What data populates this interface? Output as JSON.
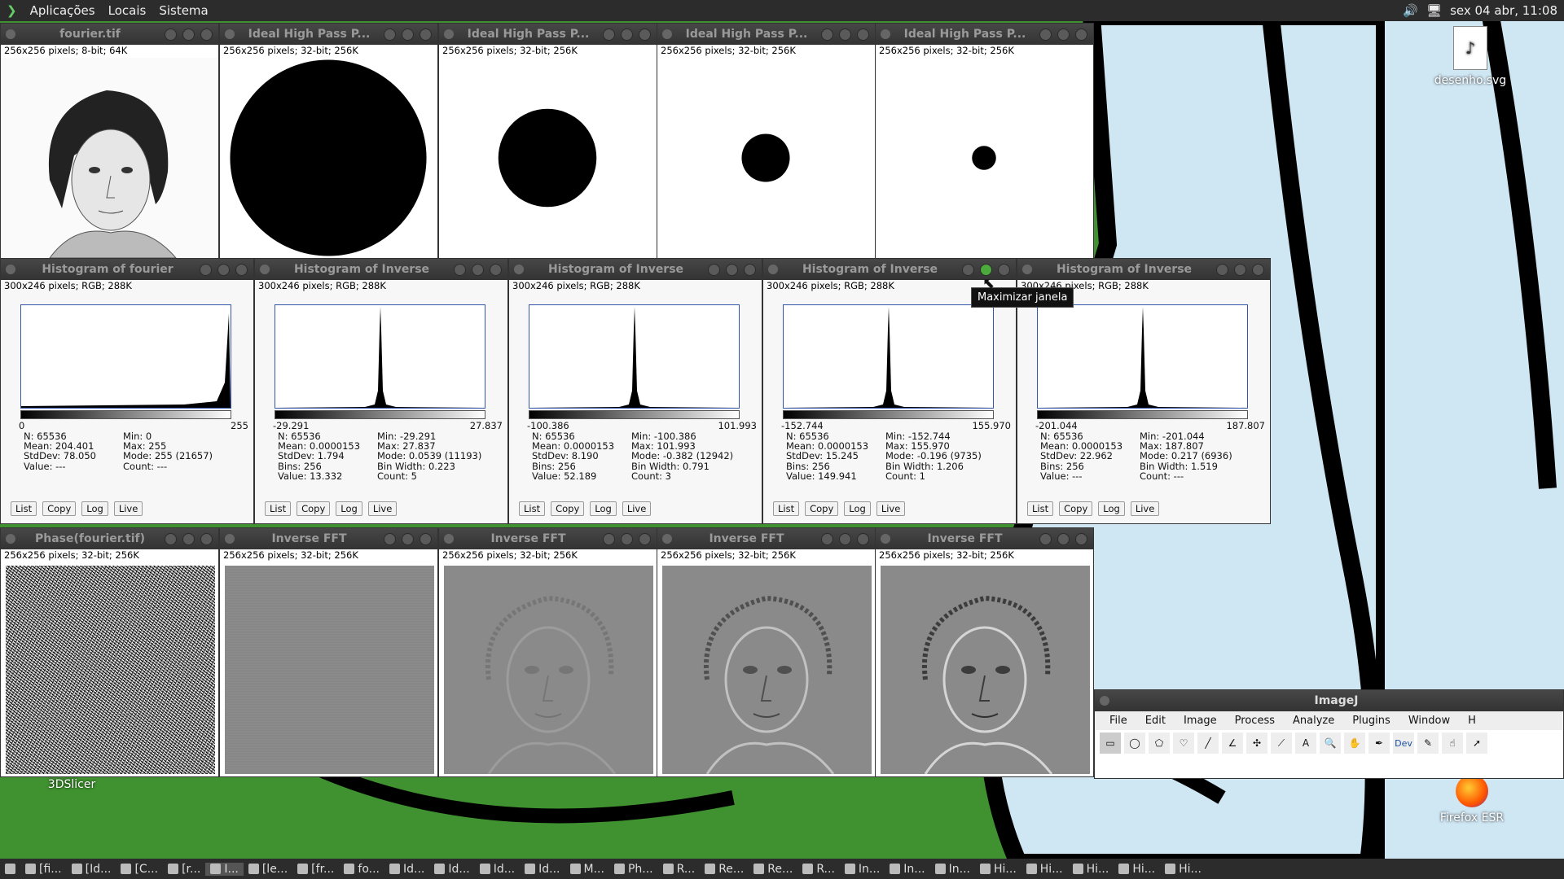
{
  "panel_top": {
    "menus": [
      "Aplicações",
      "Locais",
      "Sistema"
    ],
    "clock": "sex 04 abr, 11:08"
  },
  "image_windows": [
    {
      "title": "fourier.tif",
      "info": "256x256 pixels; 8-bit; 64K",
      "kind": "portrait"
    },
    {
      "title": "Ideal High Pass P...",
      "info": "256x256 pixels; 32-bit; 256K",
      "kind": "circle",
      "radius_frac": 0.98
    },
    {
      "title": "Ideal High Pass P...",
      "info": "256x256 pixels; 32-bit; 256K",
      "kind": "circle",
      "radius_frac": 0.49
    },
    {
      "title": "Ideal High Pass P...",
      "info": "256x256 pixels; 32-bit; 256K",
      "kind": "circle",
      "radius_frac": 0.24
    },
    {
      "title": "Ideal High Pass P...",
      "info": "256x256 pixels; 32-bit; 256K",
      "kind": "circle",
      "radius_frac": 0.12
    }
  ],
  "histogram_windows": [
    {
      "title": "Histogram of fourier",
      "info": "300x246 pixels; RGB; 288K",
      "axis_min": "0",
      "axis_max": "255",
      "shape": "right-edge",
      "stats": [
        [
          "N: 65536",
          "Min: 0"
        ],
        [
          "Mean: 204.401",
          "Max: 255"
        ],
        [
          "StdDev: 78.050",
          "Mode: 255 (21657)"
        ],
        [
          "Value: ---",
          "Count: ---"
        ]
      ]
    },
    {
      "title": "Histogram of Inverse",
      "info": "300x246 pixels; RGB; 288K",
      "axis_min": "-29.291",
      "axis_max": "27.837",
      "shape": "spike",
      "stats": [
        [
          "N: 65536",
          "Min: -29.291"
        ],
        [
          "Mean: 0.0000153",
          "Max: 27.837"
        ],
        [
          "StdDev: 1.794",
          "Mode: 0.0539 (11193)"
        ],
        [
          "Bins: 256",
          "Bin Width: 0.223"
        ],
        [
          "Value: 13.332",
          "Count: 5"
        ]
      ]
    },
    {
      "title": "Histogram of Inverse",
      "info": "300x246 pixels; RGB; 288K",
      "axis_min": "-100.386",
      "axis_max": "101.993",
      "shape": "spike",
      "stats": [
        [
          "N: 65536",
          "Min: -100.386"
        ],
        [
          "Mean: 0.0000153",
          "Max: 101.993"
        ],
        [
          "StdDev: 8.190",
          "Mode: -0.382 (12942)"
        ],
        [
          "Bins: 256",
          "Bin Width: 0.791"
        ],
        [
          "Value: 52.189",
          "Count: 3"
        ]
      ]
    },
    {
      "title": "Histogram of Inverse",
      "info": "300x246 pixels; RGB; 288K",
      "axis_min": "-152.744",
      "axis_max": "155.970",
      "shape": "spike",
      "stats": [
        [
          "N: 65536",
          "Min: -152.744"
        ],
        [
          "Mean: 0.0000153",
          "Max: 155.970"
        ],
        [
          "StdDev: 15.245",
          "Mode: -0.196 (9735)"
        ],
        [
          "Bins: 256",
          "Bin Width: 1.206"
        ],
        [
          "Value: 149.941",
          "Count: 1"
        ]
      ]
    },
    {
      "title": "Histogram of Inverse",
      "info": "300x246 pixels; RGB; 288K",
      "axis_min": "-201.044",
      "axis_max": "187.807",
      "shape": "spike",
      "stats": [
        [
          "N: 65536",
          "Min: -201.044"
        ],
        [
          "Mean: 0.0000153",
          "Max: 187.807"
        ],
        [
          "StdDev: 22.962",
          "Mode: 0.217 (6936)"
        ],
        [
          "Bins: 256",
          "Bin Width: 1.519"
        ],
        [
          "Value: ---",
          "Count: ---"
        ]
      ]
    }
  ],
  "histogram_buttons": [
    "List",
    "Copy",
    "Log",
    "Live"
  ],
  "fft_windows": [
    {
      "title": "Phase(fourier.tif)",
      "info": "256x256 pixels; 32-bit; 256K",
      "kind": "noise"
    },
    {
      "title": "Inverse FFT",
      "info": "256x256 pixels; 32-bit; 256K",
      "kind": "flat"
    },
    {
      "title": "Inverse FFT",
      "info": "256x256 pixels; 32-bit; 256K",
      "kind": "faint-face"
    },
    {
      "title": "Inverse FFT",
      "info": "256x256 pixels; 32-bit; 256K",
      "kind": "edge-face"
    },
    {
      "title": "Inverse FFT",
      "info": "256x256 pixels; 32-bit; 256K",
      "kind": "relief-face"
    }
  ],
  "tooltip": "Maximizar janela",
  "desktop_icons": [
    {
      "label": "desenho.svg"
    },
    {
      "label": "3DSlicer"
    },
    {
      "label": "Firefox ESR"
    }
  ],
  "imagej": {
    "title": "ImageJ",
    "menus": [
      "File",
      "Edit",
      "Image",
      "Process",
      "Analyze",
      "Plugins",
      "Window",
      "H"
    ],
    "dev_label": "Dev"
  },
  "taskbar": [
    "[fi...",
    "[Id...",
    "[C...",
    "[r...",
    "I...",
    "[le...",
    "[fr...",
    "fo...",
    "Id...",
    "Id...",
    "Id...",
    "Id...",
    "M...",
    "Ph...",
    "R...",
    "Re...",
    "Re...",
    "R...",
    "In...",
    "In...",
    "In...",
    "Hi...",
    "Hi...",
    "Hi...",
    "Hi...",
    "Hi..."
  ]
}
